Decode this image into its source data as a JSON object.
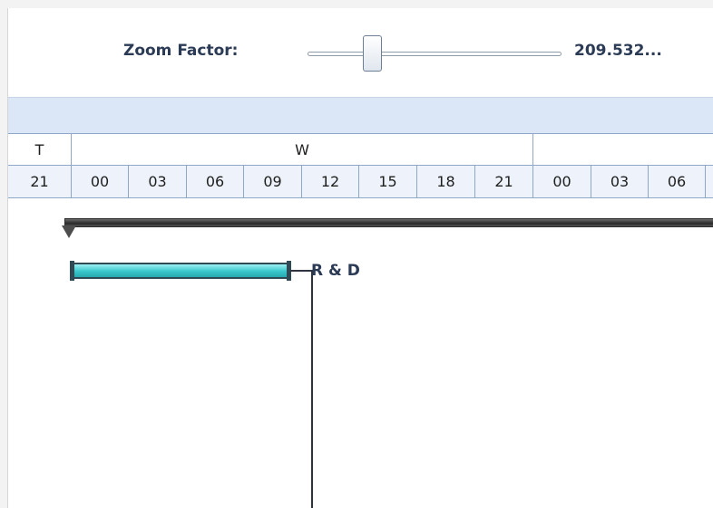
{
  "zoom": {
    "label": "Zoom Factor:",
    "value_text": "209.532...",
    "slider_level_fraction": 0.27
  },
  "timeline": {
    "days": [
      {
        "label": "T"
      },
      {
        "label": "W"
      },
      {
        "label": ""
      }
    ],
    "hours": [
      "21",
      "00",
      "03",
      "06",
      "09",
      "12",
      "15",
      "18",
      "21",
      "00",
      "03",
      "06",
      ""
    ]
  },
  "gantt": {
    "task": {
      "label": "R & D",
      "color": "#38c7cc"
    },
    "summary_color": "#333333"
  }
}
